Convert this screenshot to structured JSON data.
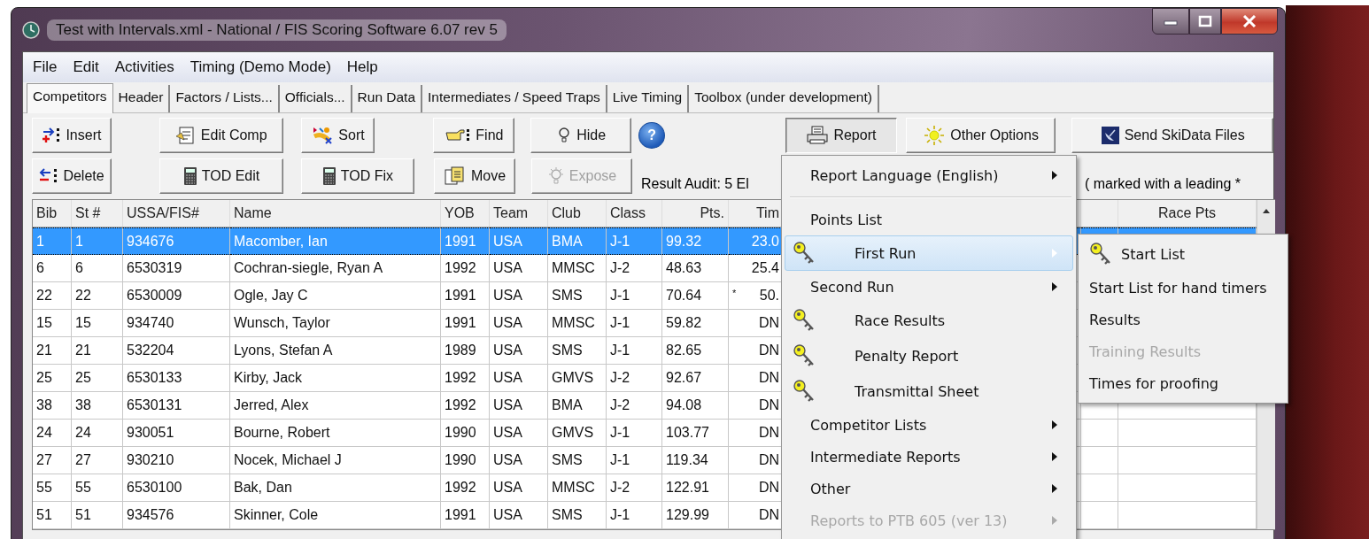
{
  "window": {
    "title": "Test with Intervals.xml - National / FIS Scoring Software 6.07 rev 5"
  },
  "menu_bar": [
    "File",
    "Edit",
    "Activities",
    "Timing (Demo Mode)",
    "Help"
  ],
  "tabs": [
    {
      "label": "Competitors",
      "selected": true
    },
    {
      "label": "Header",
      "selected": false
    },
    {
      "label": "Factors / Lists...",
      "selected": false
    },
    {
      "label": "Officials...",
      "selected": false
    },
    {
      "label": "Run Data",
      "selected": false
    },
    {
      "label": "Intermediates / Speed Traps",
      "selected": false
    },
    {
      "label": "Live Timing",
      "selected": false
    },
    {
      "label": "Toolbox (under development)",
      "selected": false
    }
  ],
  "toolbar_row_1": [
    {
      "label": "Insert",
      "kind": "insert",
      "pressed": false,
      "disabled": false
    },
    {
      "label": "Edit Comp",
      "kind": "edit",
      "pressed": false,
      "disabled": false
    },
    {
      "label": "Sort",
      "kind": "sort",
      "pressed": false,
      "disabled": false
    },
    {
      "label": "Find",
      "kind": "find",
      "pressed": false,
      "disabled": false
    },
    {
      "label": "Hide",
      "kind": "bulb",
      "pressed": false,
      "disabled": false
    },
    {
      "label": "?",
      "kind": "help",
      "pressed": false,
      "disabled": false
    },
    {
      "label": "Report",
      "kind": "print",
      "pressed": true,
      "disabled": false
    },
    {
      "label": "Other Options",
      "kind": "sun",
      "pressed": false,
      "disabled": false
    },
    {
      "label": "Send SkiData Files",
      "kind": "dish",
      "pressed": false,
      "disabled": false
    }
  ],
  "toolbar_row_2": [
    {
      "label": "Delete",
      "kind": "delete",
      "pressed": false,
      "disabled": false
    },
    {
      "label": "TOD Edit",
      "kind": "calc",
      "pressed": false,
      "disabled": false
    },
    {
      "label": "TOD Fix",
      "kind": "calc",
      "pressed": false,
      "disabled": false
    },
    {
      "label": "Move",
      "kind": "move",
      "pressed": false,
      "disabled": false
    },
    {
      "label": "Expose",
      "kind": "bulb",
      "pressed": false,
      "disabled": true
    }
  ],
  "audit_text": "Result Audit: 5 El",
  "audit_note": "( marked with a leading *",
  "table": {
    "columns": [
      "Bib",
      "St #",
      "USSA/FIS#",
      "Name",
      "YOB",
      "Team",
      "Club",
      "Class",
      "Pts.",
      "Tim",
      "Race Pts"
    ],
    "rows": [
      {
        "selected": true,
        "cells": [
          "1",
          "1",
          "934676",
          "Macomber, Ian",
          "1991",
          "USA",
          "BMA",
          "J-1",
          "99.32",
          "23.0"
        ],
        "flag": ""
      },
      {
        "selected": false,
        "cells": [
          "6",
          "6",
          "6530319",
          "Cochran-siegle, Ryan A",
          "1992",
          "USA",
          "MMSC",
          "J-2",
          "48.63",
          "25.4"
        ],
        "flag": ""
      },
      {
        "selected": false,
        "cells": [
          "22",
          "22",
          "6530009",
          "Ogle, Jay C",
          "1991",
          "USA",
          "SMS",
          "J-1",
          "70.64",
          "50."
        ],
        "flag": "*"
      },
      {
        "selected": false,
        "cells": [
          "15",
          "15",
          "934740",
          "Wunsch, Taylor",
          "1991",
          "USA",
          "MMSC",
          "J-1",
          "59.82",
          "DN"
        ],
        "flag": ""
      },
      {
        "selected": false,
        "cells": [
          "21",
          "21",
          "532204",
          "Lyons, Stefan A",
          "1989",
          "USA",
          "SMS",
          "J-1",
          "82.65",
          "DN"
        ],
        "flag": ""
      },
      {
        "selected": false,
        "cells": [
          "25",
          "25",
          "6530133",
          "Kirby, Jack",
          "1992",
          "USA",
          "GMVS",
          "J-2",
          "92.67",
          "DN"
        ],
        "flag": ""
      },
      {
        "selected": false,
        "cells": [
          "38",
          "38",
          "6530131",
          "Jerred, Alex",
          "1992",
          "USA",
          "BMA",
          "J-2",
          "94.08",
          "DN"
        ],
        "flag": ""
      },
      {
        "selected": false,
        "cells": [
          "24",
          "24",
          "930051",
          "Bourne, Robert",
          "1990",
          "USA",
          "GMVS",
          "J-1",
          "103.77",
          "DN"
        ],
        "flag": ""
      },
      {
        "selected": false,
        "cells": [
          "27",
          "27",
          "930210",
          "Nocek, Michael J",
          "1990",
          "USA",
          "SMS",
          "J-1",
          "119.34",
          "DN"
        ],
        "flag": ""
      },
      {
        "selected": false,
        "cells": [
          "55",
          "55",
          "6530100",
          "Bak, Dan",
          "1992",
          "USA",
          "MMSC",
          "J-2",
          "122.91",
          "DN"
        ],
        "flag": ""
      },
      {
        "selected": false,
        "cells": [
          "51",
          "51",
          "934576",
          "Skinner, Cole",
          "1991",
          "USA",
          "SMS",
          "J-1",
          "129.99",
          "DN"
        ],
        "flag": ""
      }
    ]
  },
  "report_menu": [
    {
      "kind": "submenu",
      "label": "Report Language (English)",
      "key": false,
      "selected": false,
      "disabled": false
    },
    {
      "kind": "separator"
    },
    {
      "kind": "item",
      "label": "Points List",
      "key": false,
      "selected": false,
      "disabled": false
    },
    {
      "kind": "submenu",
      "label": "First Run",
      "key": true,
      "selected": true,
      "disabled": false
    },
    {
      "kind": "submenu",
      "label": "Second Run",
      "key": false,
      "selected": false,
      "disabled": false
    },
    {
      "kind": "item",
      "label": "Race Results",
      "key": true,
      "selected": false,
      "disabled": false
    },
    {
      "kind": "item",
      "label": "Penalty Report",
      "key": true,
      "selected": false,
      "disabled": false
    },
    {
      "kind": "item",
      "label": "Transmittal Sheet",
      "key": true,
      "selected": false,
      "disabled": false
    },
    {
      "kind": "submenu",
      "label": "Competitor Lists",
      "key": false,
      "selected": false,
      "disabled": false
    },
    {
      "kind": "submenu",
      "label": "Intermediate Reports",
      "key": false,
      "selected": false,
      "disabled": false
    },
    {
      "kind": "submenu",
      "label": "Other",
      "key": false,
      "selected": false,
      "disabled": false
    },
    {
      "kind": "submenu",
      "label": "Reports to PTB 605 (ver 13)",
      "key": false,
      "selected": false,
      "disabled": true
    }
  ],
  "first_run_submenu": [
    {
      "label": "Start List",
      "key": true,
      "disabled": false
    },
    {
      "label": "Start List for hand timers",
      "key": false,
      "disabled": false
    },
    {
      "label": "Results",
      "key": false,
      "disabled": false
    },
    {
      "label": "Training Results",
      "key": false,
      "disabled": true
    },
    {
      "label": "Times for proofing",
      "key": false,
      "disabled": false
    }
  ]
}
